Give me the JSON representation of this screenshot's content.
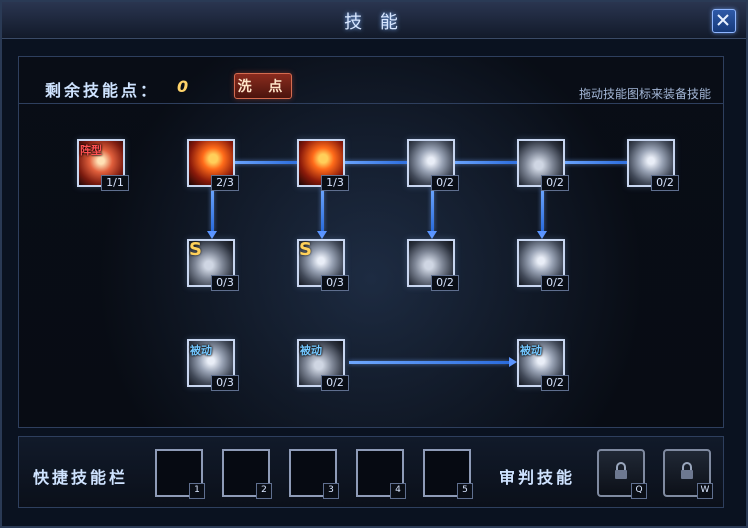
{
  "window": {
    "title": "技 能"
  },
  "header": {
    "points_label": "剩余技能点：",
    "points_value": "0",
    "reset_label": "洗 点",
    "hint": "拖动技能图标来装备技能"
  },
  "skills": [
    {
      "tag": "阵型",
      "count": "1/1",
      "style": "red"
    },
    {
      "tag": "",
      "count": "2/3",
      "style": "fire"
    },
    {
      "tag": "",
      "count": "1/3",
      "style": "fire"
    },
    {
      "tag": "",
      "count": "0/2",
      "style": "gray"
    },
    {
      "tag": "",
      "count": "0/2",
      "style": "gray2"
    },
    {
      "tag": "",
      "count": "0/2",
      "style": "gray"
    },
    {
      "tag": "S",
      "count": "0/3",
      "style": "gray2"
    },
    {
      "tag": "S",
      "count": "0/3",
      "style": "gray"
    },
    {
      "tag": "",
      "count": "0/2",
      "style": "gray2"
    },
    {
      "tag": "",
      "count": "0/2",
      "style": "gray"
    },
    {
      "tag": "被动",
      "count": "0/3",
      "style": "gray"
    },
    {
      "tag": "被动",
      "count": "0/2",
      "style": "gray2"
    },
    {
      "tag": "被动",
      "count": "0/2",
      "style": "gray"
    }
  ],
  "quickbar": {
    "label": "快捷技能栏",
    "slots": [
      {
        "key": "1",
        "style": "fire"
      },
      {
        "key": "2",
        "style": "fire"
      },
      {
        "key": "3",
        "style": "empty"
      },
      {
        "key": "4",
        "style": "empty"
      },
      {
        "key": "5",
        "style": "empty"
      }
    ],
    "judge_label": "审判技能",
    "locked_slots": [
      {
        "key": "Q"
      },
      {
        "key": "W"
      }
    ]
  }
}
